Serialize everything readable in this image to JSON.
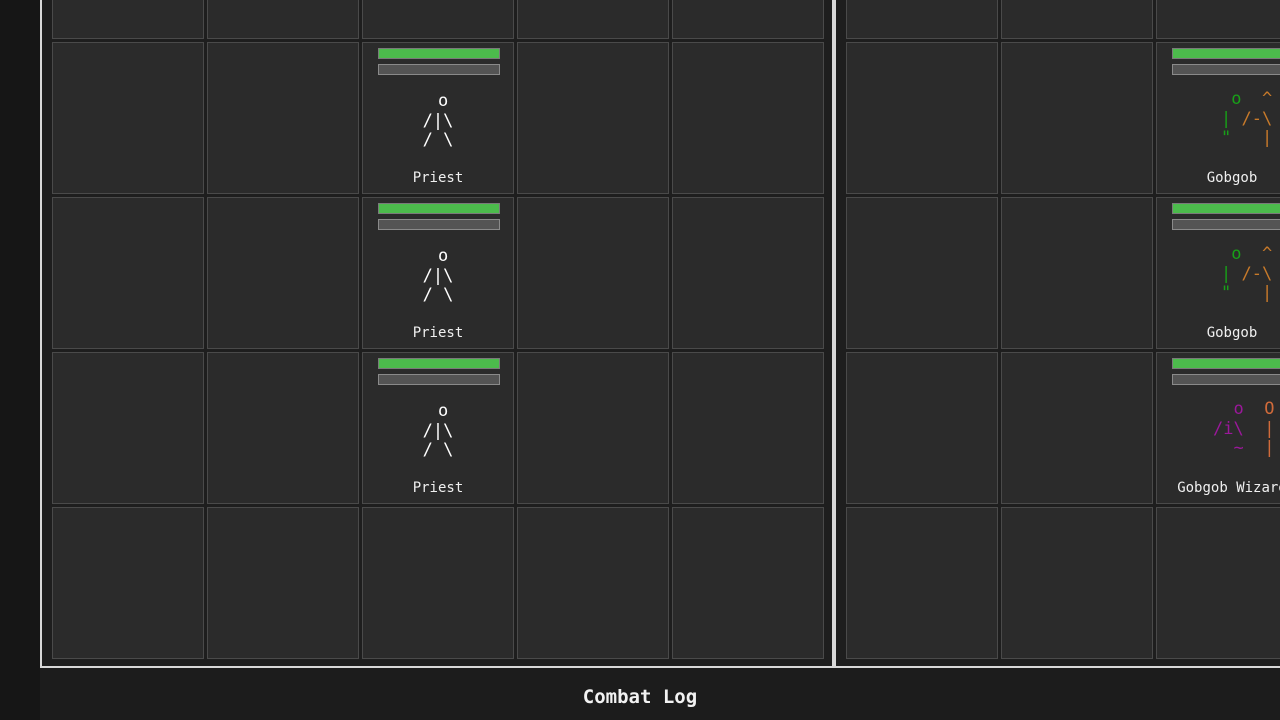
{
  "left_board": {
    "units": [
      {
        "name": "Priest",
        "sprite": " o\n/|\\\n/ \\",
        "hp": 1.0
      },
      {
        "name": "Priest",
        "sprite": " o\n/|\\\n/ \\",
        "hp": 1.0
      },
      {
        "name": "Priest",
        "sprite": " o\n/|\\\n/ \\",
        "hp": 1.0
      }
    ]
  },
  "right_board": {
    "units": [
      {
        "name": "Gobgob",
        "hp": 1.0,
        "sprite_colors": [
          "#18a018",
          "#c87a2a"
        ]
      },
      {
        "name": "Gobgob",
        "hp": 1.0,
        "sprite_colors": [
          "#18a018",
          "#c87a2a"
        ]
      },
      {
        "name": "Gobgob Wizard",
        "hp": 1.0,
        "sprite_colors": [
          "#9a189a",
          "#d06a3a"
        ]
      }
    ]
  },
  "gob_sprite": {
    "l1a": " o  ",
    "l1b": "^",
    "l2a": "|",
    "l2b": " /-\\",
    "l3a": "\"",
    "l3b": "   |"
  },
  "wizard_sprite": {
    "l1a": "  o  ",
    "l1b": "O",
    "l2a": "/i\\  ",
    "l2b": "|",
    "l3a": "  ~  ",
    "l3b": "|"
  },
  "log": {
    "title": "Combat Log"
  }
}
